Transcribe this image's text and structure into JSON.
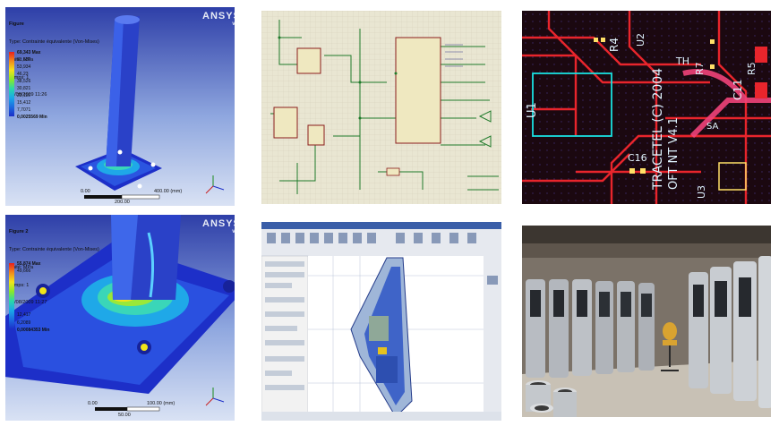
{
  "panel1": {
    "title": "Figure",
    "type": "Type: Contrainte équivalente (Von-Mises)",
    "unit": "Unité: MPa",
    "time": "Temps: 1",
    "date": "18/08/2009 11:26",
    "legend": [
      "69,343 Max",
      "61,639",
      "53,934",
      "46,23",
      "38,526",
      "30,821",
      "23,116",
      "15,412",
      "7,7071",
      "0,0025569 Min"
    ],
    "logo": "ANSYS",
    "version": "v11",
    "scale_left": "0.00",
    "scale_right": "400.00 (mm)",
    "scale_mid": "200.00",
    "colors": {
      "max": "#e8201e",
      "min": "#1c2ec8",
      "background_top": "#2e3fa8"
    }
  },
  "panel4": {
    "title": "Figure 2",
    "type": "Type: Contrainte équivalente (Von-Mises)",
    "unit": "Unité: MPa",
    "time": "Temps: 1",
    "date": "18/08/2009 11:27",
    "legend": [
      "55,874 Max",
      "49,666",
      "",
      "",
      "",
      "",
      "",
      "12,417",
      "6,2089",
      "0,00084353 Min"
    ],
    "logo": "ANSYS",
    "version": "v11",
    "scale_left": "0.00",
    "scale_right": "100.00 (mm)",
    "scale_mid": "50.00"
  },
  "panel3": {
    "labels": [
      "R4",
      "U1",
      "C16",
      "C11",
      "TRACETEL (C) 2004",
      "OFT NT V4.1",
      "R7",
      "R5",
      "U2",
      "U3",
      "SA",
      "TH"
    ],
    "colors": {
      "trace_red": "#e8252c",
      "trace_pink": "#f0437a",
      "silkscreen": "#aef6ff",
      "pads": "#ffe067"
    }
  },
  "panel6": {
    "description_icons": [
      "cabinet-icon",
      "chair-icon"
    ]
  }
}
